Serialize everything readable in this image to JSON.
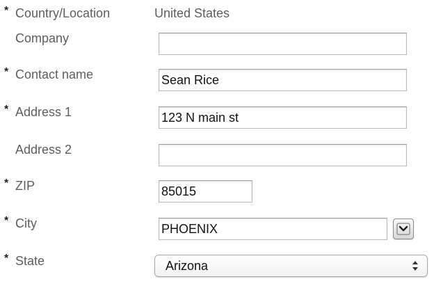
{
  "form": {
    "country": {
      "required_marker": "*",
      "label": "Country/Location",
      "value": "United States"
    },
    "company": {
      "label": "Company",
      "value": ""
    },
    "contact_name": {
      "required_marker": "*",
      "label": "Contact name",
      "value": "Sean Rice"
    },
    "address1": {
      "required_marker": "*",
      "label": "Address 1",
      "value": "123 N main st"
    },
    "address2": {
      "label": "Address 2",
      "value": ""
    },
    "zip": {
      "required_marker": "*",
      "label": "ZIP",
      "value": "85015"
    },
    "city": {
      "required_marker": "*",
      "label": "City",
      "value": "PHOENIX",
      "dropdown_icon": "chevron-down-icon"
    },
    "state": {
      "required_marker": "*",
      "label": "State",
      "value": "Arizona",
      "arrows_icon": "up-down-arrows-icon"
    }
  },
  "colors": {
    "label_text": "#5d5d5d",
    "input_text": "#111111",
    "required_marker": "#222222",
    "input_border": "#b9b9b9",
    "background": "#ffffff"
  }
}
